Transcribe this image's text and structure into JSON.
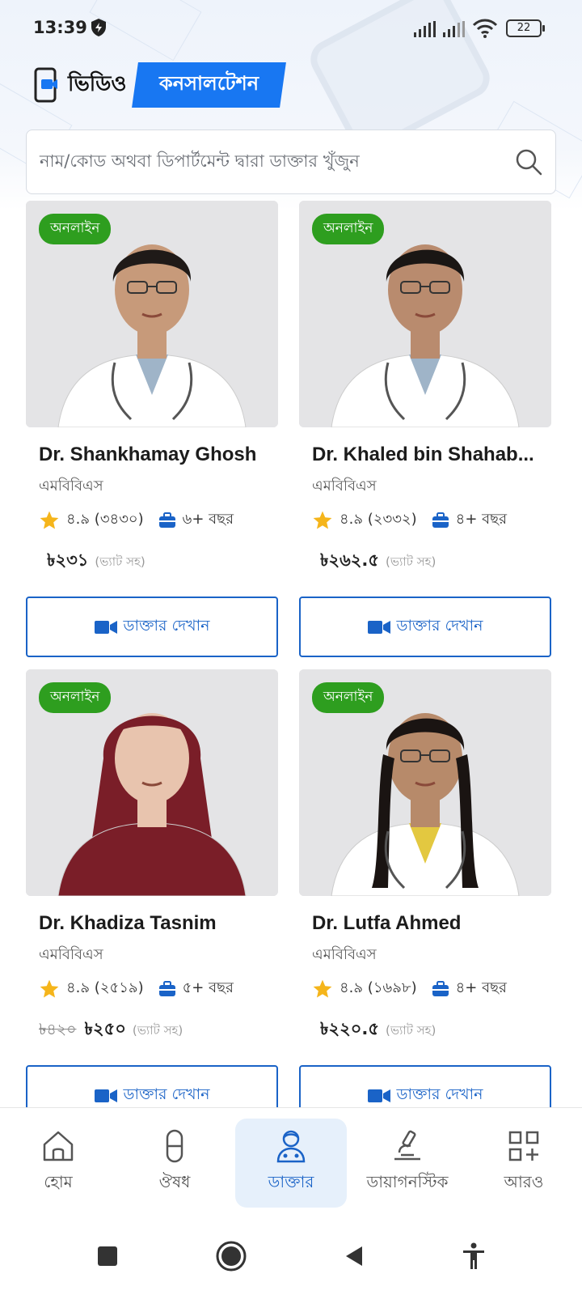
{
  "status_bar": {
    "time": "13:39",
    "battery": "22"
  },
  "header": {
    "title_part1": "ভিডিও",
    "title_part2": "কনসালটেশন"
  },
  "search": {
    "placeholder": "নাম/কোড অথবা ডিপার্টমেন্ট দ্বারা ডাক্তার খুঁজুন"
  },
  "doctors": [
    {
      "status": "অনলাইন",
      "name": "Dr. Shankhamay Ghosh",
      "degree": "এমবিবিএস",
      "rating": "৪.৯ (৩৪৩০)",
      "experience": "৬+ বছর",
      "old_price": "",
      "price": "৳২৩১",
      "vat": "(ভ্যাট সহ)",
      "button": "ডাক্তার দেখান"
    },
    {
      "status": "অনলাইন",
      "name": "Dr. Khaled bin Shahab...",
      "degree": "এমবিবিএস",
      "rating": "৪.৯ (২৩৩২)",
      "experience": "৪+ বছর",
      "old_price": "",
      "price": "৳২৬২.৫",
      "vat": "(ভ্যাট সহ)",
      "button": "ডাক্তার দেখান"
    },
    {
      "status": "অনলাইন",
      "name": "Dr. Khadiza Tasnim",
      "degree": "এমবিবিএস",
      "rating": "৪.৯ (২৫১৯)",
      "experience": "৫+ বছর",
      "old_price": "৳৪২০",
      "price": "৳২৫০",
      "vat": "(ভ্যাট সহ)",
      "button": "ডাক্তার দেখান"
    },
    {
      "status": "অনলাইন",
      "name": "Dr. Lutfa Ahmed",
      "degree": "এমবিবিএস",
      "rating": "৪.৯ (১৬৯৮)",
      "experience": "৪+ বছর",
      "old_price": "",
      "price": "৳২২০.৫",
      "vat": "(ভ্যাট সহ)",
      "button": "ডাক্তার দেখান"
    }
  ],
  "bottom_nav": [
    {
      "label": "হোম",
      "icon": "home-icon"
    },
    {
      "label": "ঔষধ",
      "icon": "pill-icon"
    },
    {
      "label": "ডাক্তার",
      "icon": "doctor-icon",
      "active": true
    },
    {
      "label": "ডায়াগনস্টিক",
      "icon": "microscope-icon"
    },
    {
      "label": "আরও",
      "icon": "more-grid-icon"
    }
  ],
  "colors": {
    "primary": "#1877f2",
    "online_badge": "#2e9e1f",
    "button_border": "#1a63c7",
    "active_nav_bg": "#e6f0fb"
  }
}
